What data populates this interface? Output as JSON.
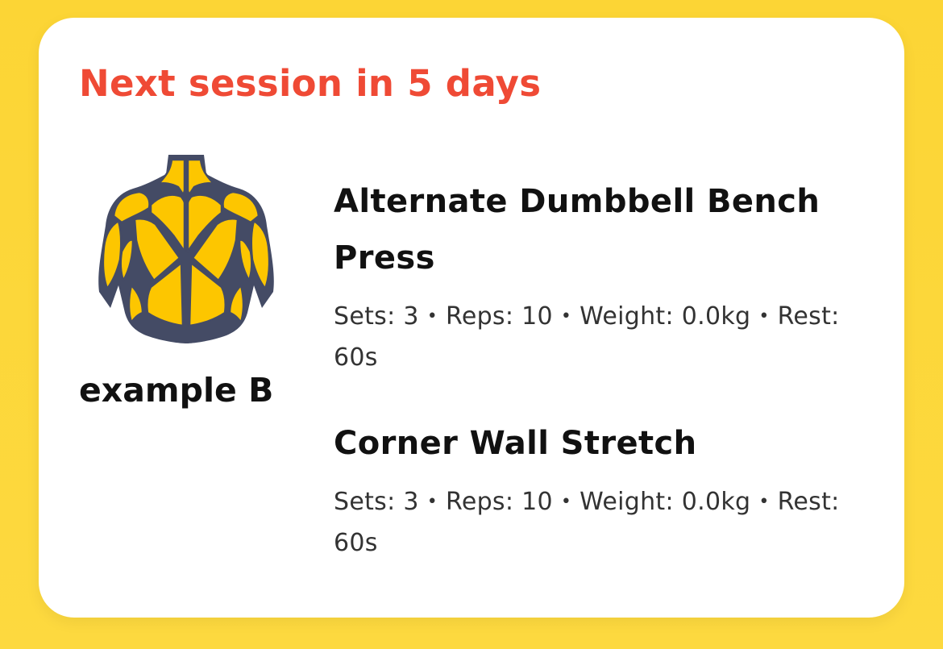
{
  "card": {
    "header": "Next session in 5 days",
    "routine": {
      "name": "example B",
      "icon": "upper-body-back-muscles-icon",
      "colors": {
        "muscle": "#FDC600",
        "outline": "#444B65"
      }
    },
    "exercises": [
      {
        "title": "Alternate Dumbbell Bench Press",
        "details": {
          "sets": "Sets: 3",
          "reps": "Reps: 10",
          "weight": "Weight: 0.0kg",
          "rest": "Rest: 60s"
        }
      },
      {
        "title": "Corner Wall Stretch",
        "details": {
          "sets": "Sets: 3",
          "reps": "Reps: 10",
          "weight": "Weight: 0.0kg",
          "rest": "Rest: 60s"
        }
      }
    ]
  },
  "colors": {
    "background": "#FCD535",
    "card": "#FFFFFF",
    "accent": "#EF4A35",
    "text": "#111111"
  }
}
